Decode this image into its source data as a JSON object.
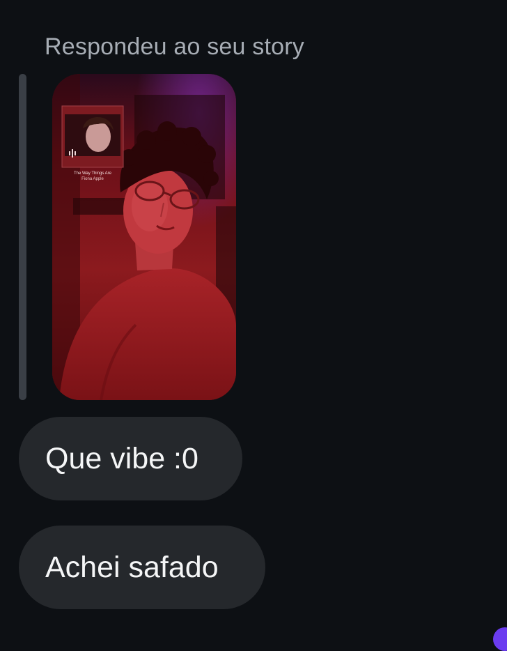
{
  "thread": {
    "reply_label": "Respondeu ao seu story"
  },
  "story": {
    "song_title": "The Way Things Are",
    "song_artist": "Fiona Apple"
  },
  "messages": [
    {
      "text": "Que vibe :0"
    },
    {
      "text": "Achei safado"
    }
  ],
  "colors": {
    "background": "#0d1014",
    "bubble": "#25282c",
    "label": "#a7adb5",
    "accent": "#6b3cf0"
  }
}
